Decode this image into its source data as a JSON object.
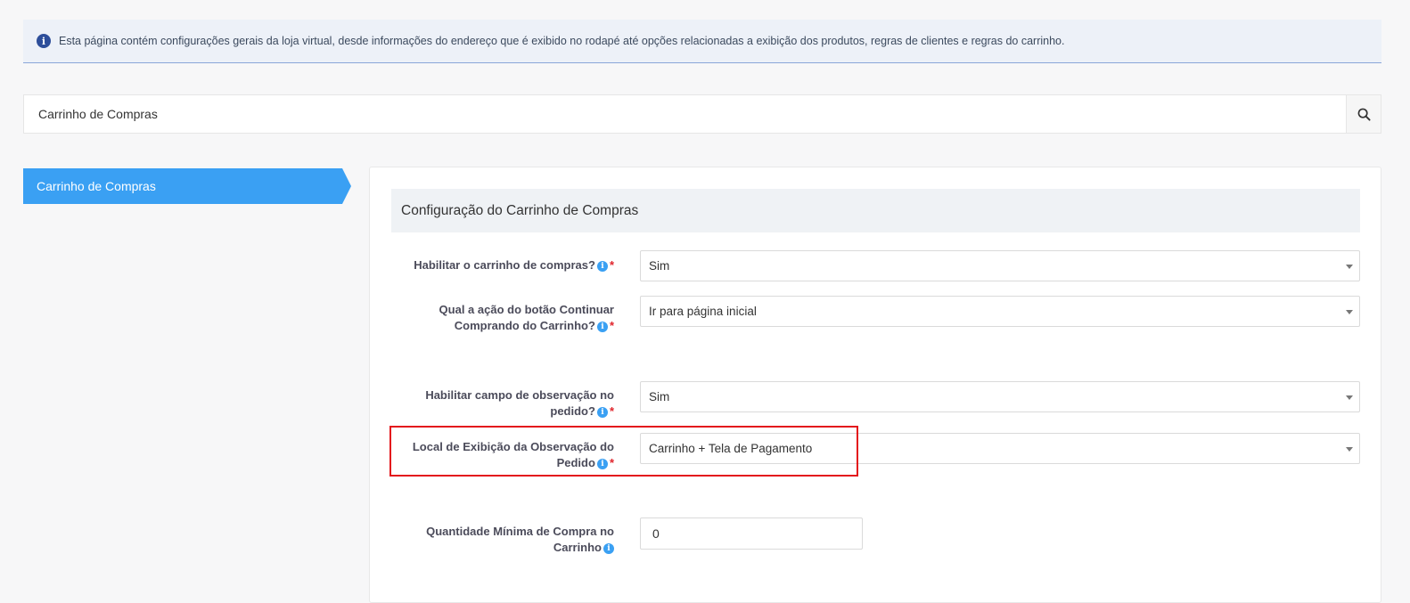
{
  "info_banner": {
    "icon": "info-icon",
    "text": "Esta página contém configurações gerais da loja virtual, desde informações do endereço que é exibido no rodapé até opções relacionadas a exibição dos produtos, regras de clientes e regras do carrinho."
  },
  "search": {
    "value": "Carrinho de Compras",
    "icon": "search-icon"
  },
  "sidebar": {
    "items": [
      {
        "label": "Carrinho de Compras",
        "active": true
      }
    ]
  },
  "section": {
    "title": "Configuração do Carrinho de Compras"
  },
  "fields": [
    {
      "label_line1": "Habilitar o carrinho de compras?",
      "label_line2": "",
      "required": "*",
      "value": "Sim"
    },
    {
      "label_line1": "Qual a ação do botão Continuar",
      "label_line2": "Comprando do Carrinho?",
      "required": "*",
      "value": "Ir para página inicial"
    },
    {
      "label_line1": "Habilitar campo de observação no",
      "label_line2": "pedido?",
      "required": "*",
      "value": "Sim"
    },
    {
      "label_line1": "Local de Exibição da Observação do",
      "label_line2": "Pedido",
      "required": "*",
      "value": "Carrinho + Tela de Pagamento"
    },
    {
      "label_line1": "Quantidade Mínima de Compra no",
      "label_line2": "Carrinho",
      "required": "",
      "value": "0"
    }
  ],
  "colors": {
    "accent": "#3aa0f3",
    "highlight": "#e3161c",
    "required": "#e0242b"
  }
}
